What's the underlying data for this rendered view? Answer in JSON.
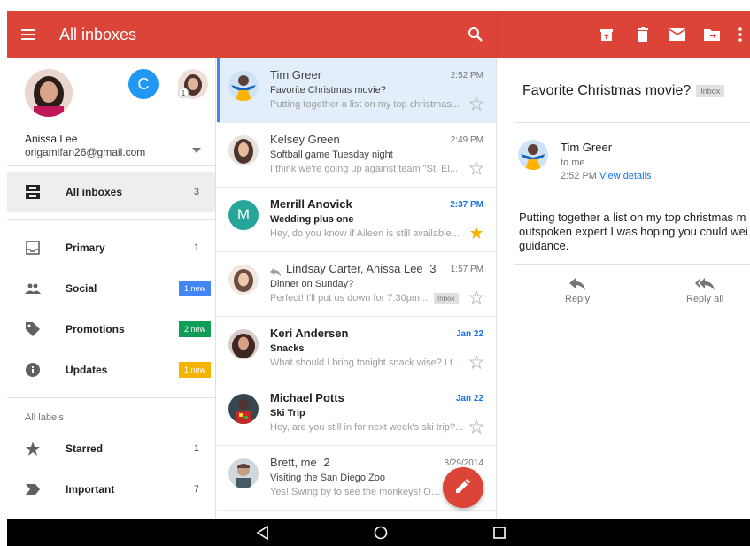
{
  "appbar": {
    "title": "All inboxes",
    "icons": [
      "menu-icon",
      "search-icon",
      "archive-icon",
      "delete-icon",
      "mail-icon",
      "move-to-folder-icon",
      "more-vert-icon"
    ],
    "color": "#db4437"
  },
  "drawer": {
    "account": {
      "name": "Anissa Lee",
      "email": "origamifan26@gmail.com",
      "secondary_letter": "C",
      "small_badge": "1"
    },
    "items": [
      {
        "label": "All inboxes",
        "count": "3",
        "icon": "all-inboxes-icon"
      },
      {
        "label": "Primary",
        "count": "1",
        "icon": "inbox-icon"
      },
      {
        "label": "Social",
        "badge": "1 new",
        "badge_color": "#4285f4",
        "icon": "people-icon"
      },
      {
        "label": "Promotions",
        "badge": "2 new",
        "badge_color": "#0f9d58",
        "icon": "tag-icon"
      },
      {
        "label": "Updates",
        "badge": "1 new",
        "badge_color": "#f4b400",
        "icon": "info-icon"
      }
    ],
    "section_label": "All labels",
    "labels": [
      {
        "label": "Starred",
        "count": "1",
        "icon": "star-icon"
      },
      {
        "label": "Important",
        "count": "7",
        "icon": "important-icon"
      }
    ]
  },
  "list": {
    "rows": [
      {
        "sender": "Tim Greer",
        "time": "2:52 PM",
        "subject": "Favorite Christmas movie?",
        "snippet": "Putting together a list on my top christmas...",
        "unread": false,
        "starred": false
      },
      {
        "sender": "Kelsey Green",
        "time": "2:49 PM",
        "subject": "Softball game Tuesday night",
        "snippet": "I think we're going up against team \"St. El...",
        "unread": false,
        "starred": false
      },
      {
        "sender": "Merrill Anovick",
        "time": "2:37 PM",
        "subject": "Wedding plus one",
        "snippet": "Hey, do you know if Aileen is still available...",
        "unread": true,
        "starred": true,
        "letter": "M"
      },
      {
        "sender": "Lindsay Carter, Anissa Lee",
        "thread_count": "3",
        "time": "1:57 PM",
        "subject": "Dinner on Sunday?",
        "snippet": "Perfect! I'll put us down for 7:30pm...",
        "tag": "Inbox",
        "unread": false,
        "starred": false
      },
      {
        "sender": "Keri Andersen",
        "time": "Jan 22",
        "subject": "Snacks",
        "snippet": "What should I bring tonight snack wise? I t...",
        "unread": true,
        "starred": false
      },
      {
        "sender": "Michael Potts",
        "time": "Jan 22",
        "subject": "Ski Trip",
        "snippet": "Hey, are you still in for next week's ski trip?...",
        "unread": true,
        "starred": false
      },
      {
        "sender": "Brett, me",
        "thread_count": "2",
        "time": "8/29/2014",
        "subject": "Visiting the San Diego Zoo",
        "snippet": "Yes! Swing by to see the monkeys! On F",
        "unread": false,
        "starred": false
      }
    ]
  },
  "detail": {
    "subject": "Favorite Christmas movie?",
    "tag": "Inbox",
    "sender": "Tim Greer",
    "to": "to me",
    "time": "2:52 PM",
    "view_details": "View details",
    "body": "Putting together a list on my top christmas m outspoken expert I was hoping you could wei guidance.",
    "actions": {
      "reply": "Reply",
      "reply_all": "Reply all"
    }
  },
  "colors": {
    "accent": "#db4437",
    "selected_row": "#e3eefb",
    "link": "#1a73e8",
    "star": "#f4b400"
  }
}
